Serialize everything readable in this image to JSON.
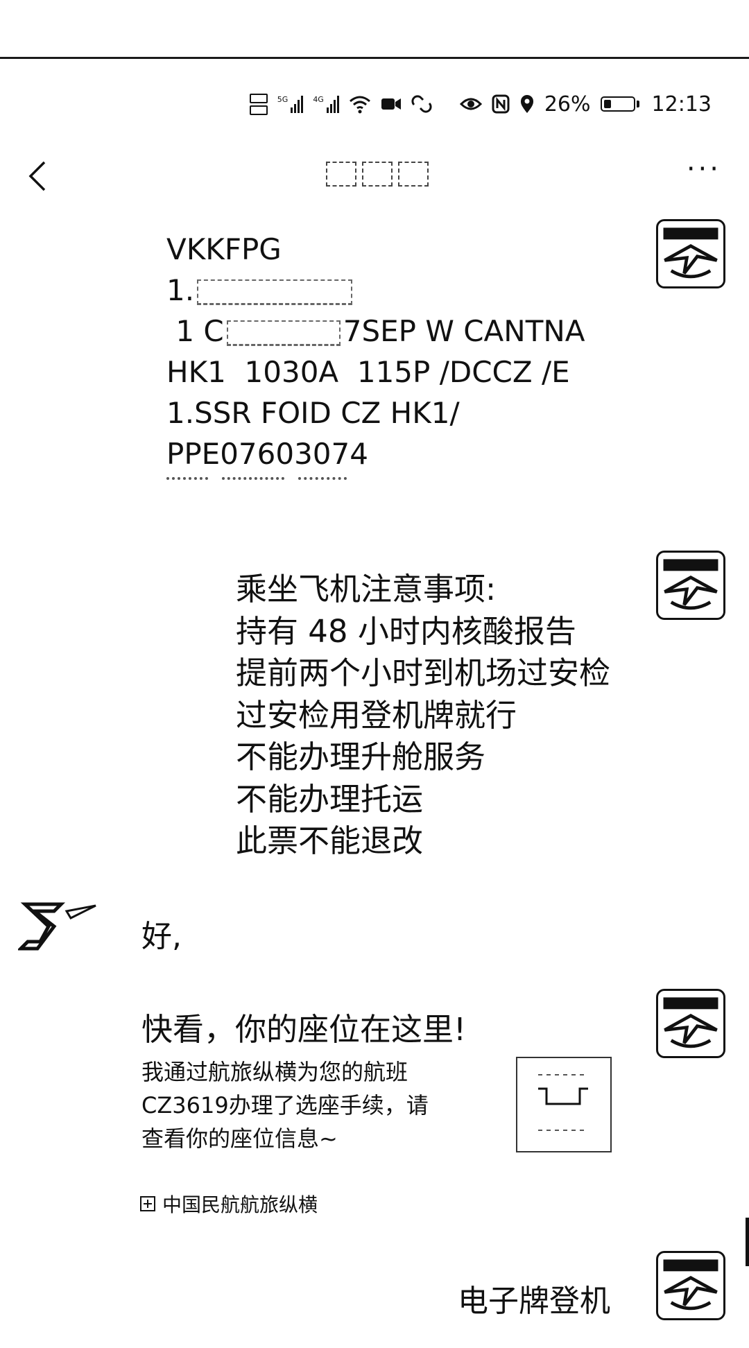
{
  "status_bar": {
    "signal_1_label": "5G",
    "signal_2_label": "4G",
    "battery_percent": "26%",
    "battery_level": 0.26,
    "time": "12:13"
  },
  "header": {
    "back_icon": "chevron-left-icon",
    "more_label": "···"
  },
  "messages": {
    "pnr": {
      "line1": "VKKFPG",
      "line2_prefix": "1.",
      "line3_prefix": " 1 C",
      "line3_suffix": "7SEP W CANTNA",
      "line4": "HK1  1030A  115P /DCCZ /E",
      "line5": "1.SSR FOID CZ HK1/",
      "line6": "PPE07603074"
    },
    "notice": {
      "lines": [
        "乘坐飞机注意事项:",
        "持有 48 小时内核酸报告",
        "提前两个小时到机场过安检",
        "过安检用登机牌就行",
        "不能办理升舱服务",
        "不能办理托运",
        "此票不能退改"
      ]
    },
    "reply": "好,",
    "card": {
      "title": "快看，你的座位在这里!",
      "body_lines": [
        "我通过航旅纵横为您的航班",
        "CZ3619办理了选座手续，请",
        "查看你的座位信息~"
      ],
      "source": "中国民航航旅纵横"
    },
    "last": "电子牌登机"
  }
}
